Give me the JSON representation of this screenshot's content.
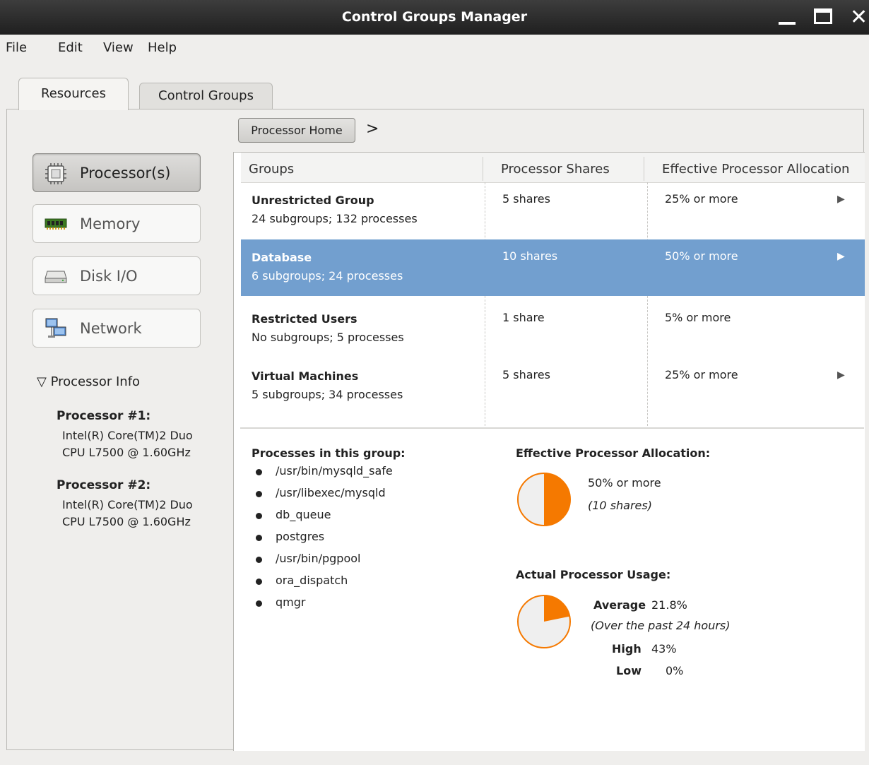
{
  "window": {
    "title": "Control Groups Manager"
  },
  "menu": [
    "File",
    "Edit",
    "View",
    "Help"
  ],
  "tabs": {
    "resources": "Resources",
    "control_groups": "Control Groups"
  },
  "sidebar": {
    "items": [
      {
        "label": "Processor(s)",
        "icon": "processor-icon",
        "active": true
      },
      {
        "label": "Memory",
        "icon": "memory-icon",
        "active": false
      },
      {
        "label": "Disk I/O",
        "icon": "disk-icon",
        "active": false
      },
      {
        "label": "Network",
        "icon": "network-icon",
        "active": false
      }
    ],
    "info_toggle": "Processor Info",
    "processors": [
      {
        "title": "Processor #1:",
        "line1": "Intel(R) Core(TM)2 Duo",
        "line2": "CPU L7500 @ 1.60GHz"
      },
      {
        "title": "Processor #2:",
        "line1": "Intel(R) Core(TM)2 Duo",
        "line2": "CPU L7500 @ 1.60GHz"
      }
    ]
  },
  "breadcrumb": {
    "home": "Processor Home",
    "separator": ">"
  },
  "table": {
    "columns": [
      "Groups",
      "Processor Shares",
      "Effective Processor Allocation"
    ],
    "rows": [
      {
        "name": "Unrestricted Group",
        "sub": "24 subgroups; 132 processes",
        "shares": "5 shares",
        "alloc": "25% or more",
        "arrow": true,
        "selected": false
      },
      {
        "name": "Database",
        "sub": "6 subgroups; 24 processes",
        "shares": "10 shares",
        "alloc": "50% or more",
        "arrow": true,
        "selected": true
      },
      {
        "name": "Restricted Users",
        "sub": "No subgroups; 5 processes",
        "shares": "1 share",
        "alloc": "5% or more",
        "arrow": false,
        "selected": false
      },
      {
        "name": "Virtual Machines",
        "sub": "5 subgroups; 34 processes",
        "shares": "5 shares",
        "alloc": "25% or more",
        "arrow": true,
        "selected": false
      }
    ]
  },
  "detail": {
    "processes_title": "Processes in this group:",
    "processes": [
      "/usr/bin/mysqld_safe",
      "/usr/libexec/mysqld",
      "db_queue",
      "postgres",
      "/usr/bin/pgpool",
      "ora_dispatch",
      "qmgr"
    ],
    "allocation": {
      "title": "Effective Processor Allocation:",
      "value": "50% or more",
      "note": "(10 shares)",
      "fraction": 0.5
    },
    "usage": {
      "title": "Actual Processor Usage:",
      "average_label": "Average",
      "average_value": "21.8%",
      "note": "(Over the past 24 hours)",
      "high_label": "High",
      "high_value": "43%",
      "low_label": "Low",
      "low_value": "0%",
      "fraction": 0.218
    }
  },
  "colors": {
    "accent": "#f57900",
    "selection": "#729fcf"
  }
}
